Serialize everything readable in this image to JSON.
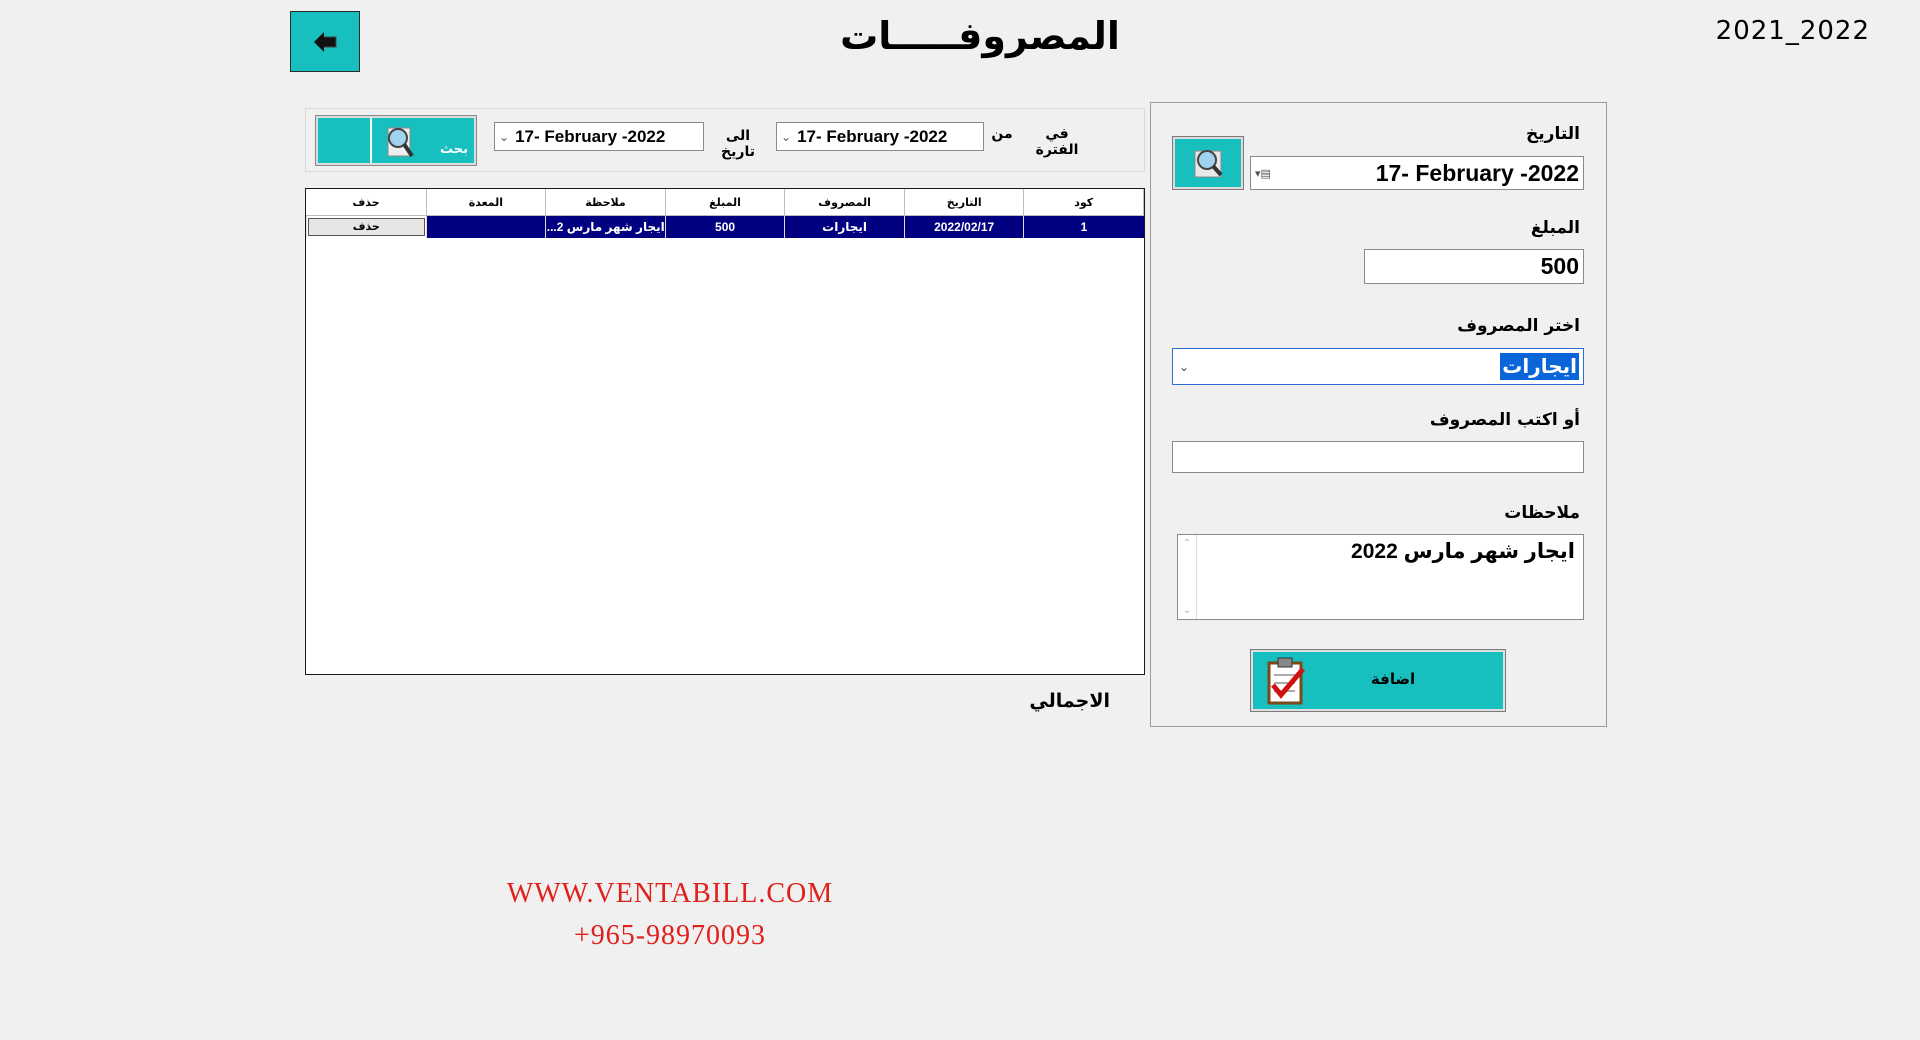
{
  "header": {
    "title": "المصروفـــــات",
    "year": "2021_2022"
  },
  "form": {
    "date_label": "التاريخ",
    "date_value": "17-  February  -2022",
    "amount_label": "المبلغ",
    "amount_value": "500",
    "choose_expense_label": "اختر المصروف",
    "choose_expense_value": "ايجارات",
    "write_expense_label": "أو اكتب المصروف",
    "write_expense_value": "",
    "notes_label": "ملاحظات",
    "notes_value": "ايجار شهر مارس 2022",
    "add_button_label": "اضافة"
  },
  "filter": {
    "period_label": "في الفترة",
    "from_label": "من",
    "from_value": "17-  February  -2022",
    "to_label": "الى تاريخ",
    "to_value": "17-  February  -2022",
    "search_label": "بحث"
  },
  "table": {
    "headers": [
      "كود",
      "التاريخ",
      "المصروف",
      "المبلغ",
      "ملاحظة",
      "المعدة",
      "حذف"
    ],
    "rows": [
      {
        "code": "1",
        "date": "2022/02/17",
        "expense": "ايجارات",
        "amount": "500",
        "note": "ايجار شهر مارس 2...",
        "prepared": "",
        "delete": "حذف"
      }
    ]
  },
  "total_label": "الاجمالي",
  "footer": {
    "website": "WWW.VENTABILL.COM",
    "phone": "+965-98970093"
  },
  "colors": {
    "accent": "#17bfbf",
    "selected_row": "#000080",
    "selection": "#0a66d8",
    "footer_text": "#e0201a"
  }
}
